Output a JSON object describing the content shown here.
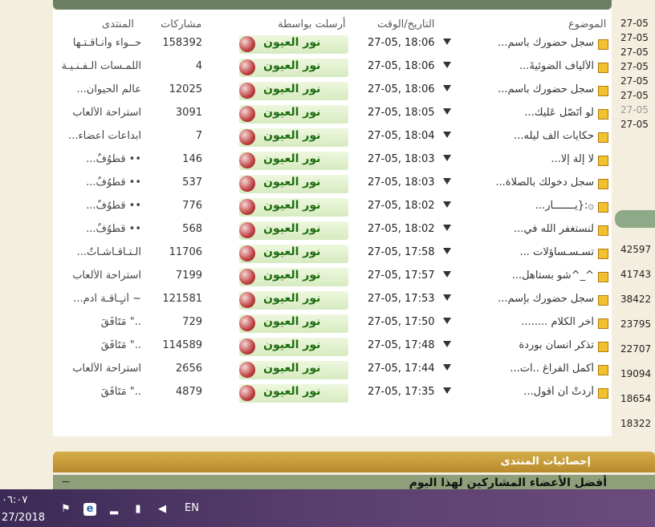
{
  "headers": {
    "subject": "الموضوع",
    "datetime": "التاريخ/الوقت",
    "posted_by": "أرسلت بواسطة",
    "posts": "مشاركات",
    "forum": "المنتدى"
  },
  "rows": [
    {
      "subject": "سجل حضورك بأسم...",
      "date": "27-05, 18:06",
      "user": "نور العيون",
      "posts": "158392",
      "forum": "حــواء وأنـاقـتـها"
    },
    {
      "subject": "الأليآف الضوئيةَ...",
      "date": "27-05, 18:06",
      "user": "نور العيون",
      "posts": "4",
      "forum": "اللمـسات الـفـنـيـة"
    },
    {
      "subject": "سجل حضورك باسم...",
      "date": "27-05, 18:06",
      "user": "نور العيون",
      "posts": "12025",
      "forum": "عالم الحيوان..."
    },
    {
      "subject": "لُو أتَصّل عَليك...",
      "date": "27-05, 18:05",
      "user": "نور العيون",
      "posts": "3091",
      "forum": "استراحة الألعاب"
    },
    {
      "subject": "حكايات الف ليله...",
      "date": "27-05, 18:04",
      "user": "نور العيون",
      "posts": "7",
      "forum": "ابداعات أعضاء..."
    },
    {
      "subject": "لا إلة إلّا...",
      "date": "27-05, 18:03",
      "user": "نور العيون",
      "posts": "146",
      "forum": "•• قطوُفٌ..."
    },
    {
      "subject": "سجل دخولك بالصلاة...",
      "date": "27-05, 18:03",
      "user": "نور العيون",
      "posts": "537",
      "forum": "•• قطوُفٌ..."
    },
    {
      "subject": "۞:{يـــــــآر...",
      "date": "27-05, 18:02",
      "user": "نور العيون",
      "posts": "776",
      "forum": "•• قطوُفٌ..."
    },
    {
      "subject": "لنستغفر الله في...",
      "date": "27-05, 18:02",
      "user": "نور العيون",
      "posts": "568",
      "forum": "•• قطوُفٌ..."
    },
    {
      "subject": "تسـسـساؤلات ...",
      "date": "27-05, 17:58",
      "user": "نور العيون",
      "posts": "11706",
      "forum": "الـتـآقـآشـآتٌ..."
    },
    {
      "subject": "^_^شو بستاهل...",
      "date": "27-05, 17:57",
      "user": "نور العيون",
      "posts": "7199",
      "forum": "استراحة الألعاب"
    },
    {
      "subject": "سجل حضورك بإسم...",
      "date": "27-05, 17:53",
      "user": "نور العيون",
      "posts": "121581",
      "forum": "~ أنـٍـآقـة آدم..."
    },
    {
      "subject": "آخر الكلام ........",
      "date": "27-05, 17:50",
      "user": "نور العيون",
      "posts": "729",
      "forum": "..\" مَتَآفَقَ"
    },
    {
      "subject": "تذكر انسان بوردة",
      "date": "27-05, 17:48",
      "user": "نور العيون",
      "posts": "114589",
      "forum": "..\" مَتَآفَقَ"
    },
    {
      "subject": "أكمل الفراغ ..آت...",
      "date": "27-05, 17:44",
      "user": "نور العيون",
      "posts": "2656",
      "forum": "استراحة الألعاب"
    },
    {
      "subject": "أردتْ أن أقول...",
      "date": "27-05, 17:35",
      "user": "نور العيون",
      "posts": "4879",
      "forum": "..\" مَتَآفَقَ"
    }
  ],
  "right_dates": [
    "27-05",
    "27-05",
    "27-05",
    "27-05",
    "27-05",
    "27-05",
    "27-05",
    "27-05"
  ],
  "right_numbers": [
    "42597",
    "41743",
    "38422",
    "23795",
    "22707",
    "19094",
    "18654",
    "18322"
  ],
  "stats_bar": "إحصائيات المنتدى",
  "top_members_bar": "أفضل الأعضاء المشاركين لهذا اليوم",
  "collapse_symbol": "−",
  "taskbar": {
    "time": "٠٦:٠٧",
    "date": "27/2018",
    "language": "EN",
    "icons": [
      "flag-icon",
      "edge-icon",
      "signal-icon",
      "battery-icon",
      "volume-icon"
    ]
  }
}
